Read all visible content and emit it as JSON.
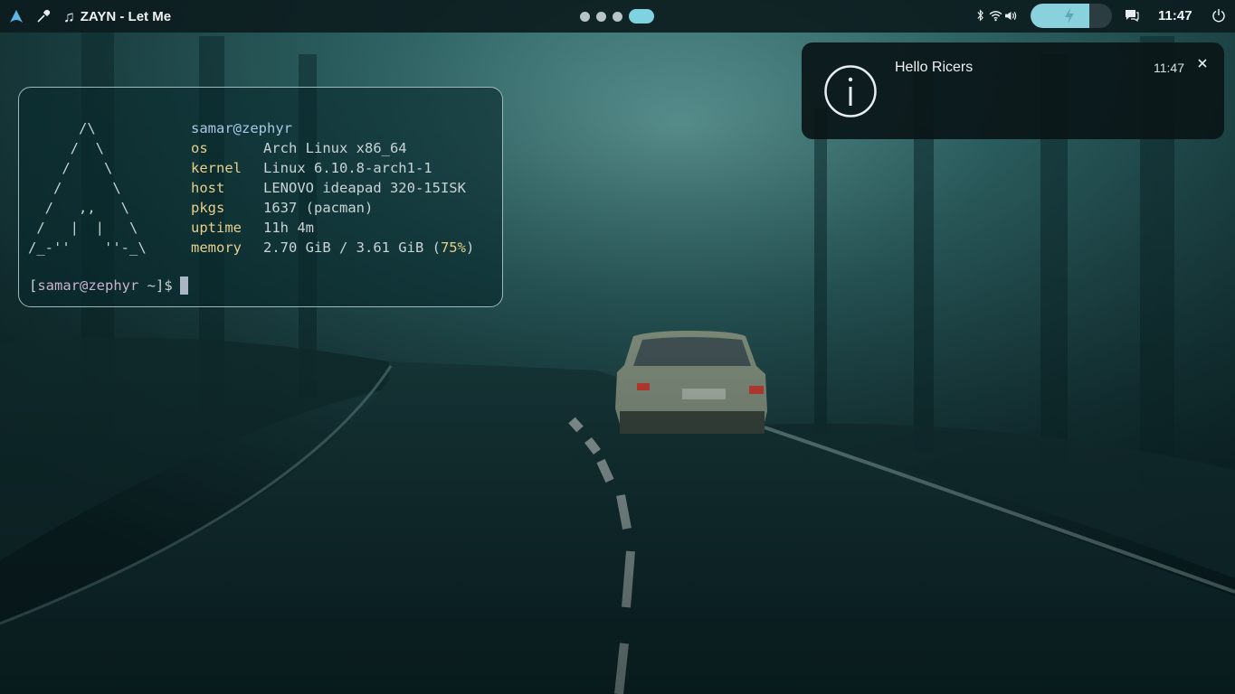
{
  "topbar": {
    "launcher_icon": "arch-linux-icon",
    "picker_icon": "color-picker-icon",
    "media": {
      "icon": "music-note-icon",
      "title": "ZAYN - Let Me"
    },
    "workspaces": {
      "count": 4,
      "active_index": 3
    },
    "status_icons": [
      "bluetooth-icon",
      "wifi-icon",
      "volume-icon"
    ],
    "battery": {
      "level": 0.72,
      "charging": true,
      "accent": "#8ad1de"
    },
    "notifications_icon": "chat-bubble-icon",
    "clock": "11:47",
    "power_icon": "power-icon"
  },
  "terminal": {
    "ascii_art": "      /\\\n     /  \\\n    /    \\\n   /      \\\n  /   ,,   \\\n /   |  |   \\\n/_-''    ''-_\\",
    "user_host": "samar@zephyr",
    "info": [
      {
        "key": "os",
        "value": "Arch Linux x86_64"
      },
      {
        "key": "kernel",
        "value": "Linux 6.10.8-arch1-1"
      },
      {
        "key": "host",
        "value": "LENOVO ideapad 320-15ISK"
      },
      {
        "key": "pkgs",
        "value": "1637 (pacman)"
      },
      {
        "key": "uptime",
        "value": "11h 4m"
      }
    ],
    "memory": {
      "key": "memory",
      "value": "2.70 GiB / 3.61 GiB (",
      "percent": "75%",
      "close": ")"
    },
    "prompt": {
      "open": "[",
      "user_host": "samar@zephyr",
      "dir": " ~",
      "close": "]$"
    }
  },
  "notification": {
    "icon": "info-icon",
    "title": "Hello Ricers",
    "time": "11:47",
    "close_icon": "close-icon"
  },
  "colors": {
    "key_yellow": "#e5cf8a",
    "user_blue": "#a8c8e6",
    "prompt_pink": "#c9b3cd"
  }
}
